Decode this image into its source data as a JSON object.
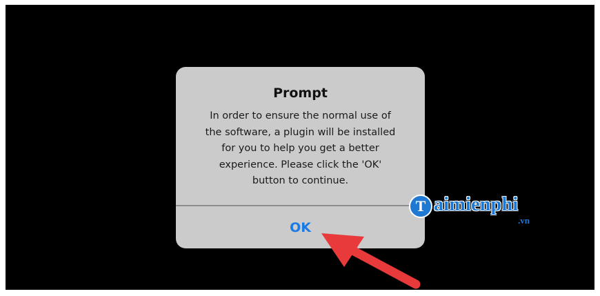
{
  "dialog": {
    "title": "Prompt",
    "message_lines": [
      "In order to ensure the normal use of",
      "the software, a plugin will be installed",
      "for you to help you get a better",
      "experience. Please click the 'OK'",
      "button to continue."
    ],
    "ok_label": "OK"
  },
  "watermark": {
    "logo_letter": "T",
    "name": "aimienphi",
    "suffix": ".vn"
  },
  "annotation": {
    "arrow_color": "#e8393b",
    "icon": "arrow-pointer"
  },
  "colors": {
    "background": "#000000",
    "dialog": "#cbcbcb",
    "accent": "#1a7be6",
    "brand": "#1f78d1"
  }
}
